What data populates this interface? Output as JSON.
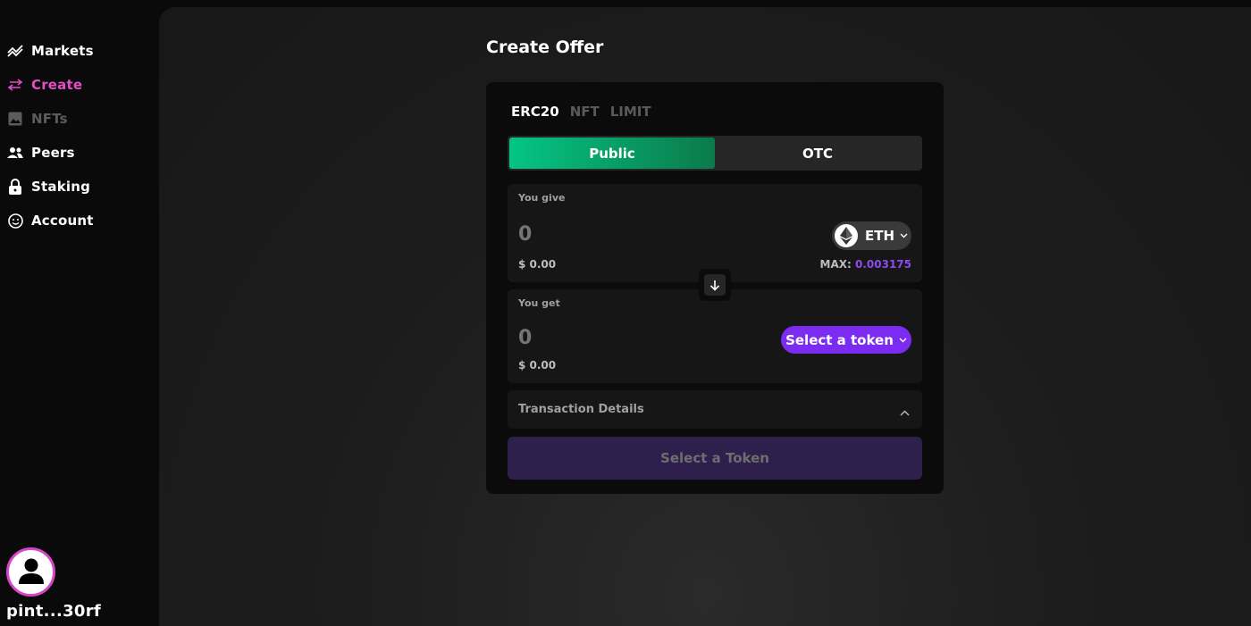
{
  "sidebar": {
    "items": [
      {
        "label": "Markets",
        "icon": "chart-line-icon",
        "state": "normal"
      },
      {
        "label": "Create",
        "icon": "swap-arrows-icon",
        "state": "active"
      },
      {
        "label": "NFTs",
        "icon": "image-icon",
        "state": "disabled"
      },
      {
        "label": "Peers",
        "icon": "people-icon",
        "state": "normal"
      },
      {
        "label": "Staking",
        "icon": "lock-icon",
        "state": "normal"
      },
      {
        "label": "Account",
        "icon": "smiley-icon",
        "state": "normal"
      }
    ],
    "user": {
      "address": "pint...30rf"
    }
  },
  "page": {
    "title": "Create Offer"
  },
  "offer": {
    "type_tabs": [
      "ERC20",
      "NFT",
      "LIMIT"
    ],
    "active_type": "ERC20",
    "modes": [
      "Public",
      "OTC"
    ],
    "active_mode": "Public",
    "give": {
      "label": "You give",
      "amount_placeholder": "0",
      "usd": "$ 0.00",
      "token": "ETH",
      "max_label": "MAX:",
      "max_value": "0.003175"
    },
    "get": {
      "label": "You get",
      "amount_placeholder": "0",
      "usd": "$ 0.00",
      "select_label": "Select a token"
    },
    "details_label": "Transaction Details",
    "submit_label": "Select a Token"
  },
  "colors": {
    "accent_pink": "#e24ec6",
    "public_green": "#04c585",
    "token_purple": "#7b2cf0",
    "max_purple": "#8a4cf0",
    "submit_disabled": "#2f1f4d"
  }
}
